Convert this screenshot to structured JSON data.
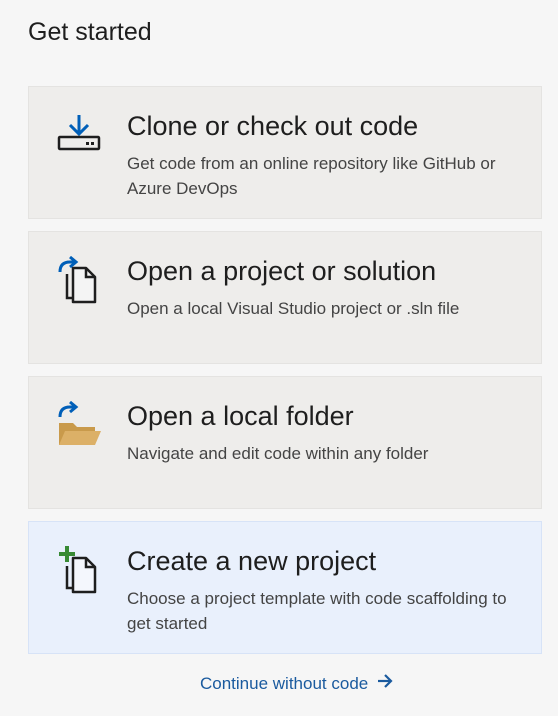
{
  "header": {
    "title": "Get started"
  },
  "cards": [
    {
      "icon": "clone-download-icon",
      "title": "Clone or check out code",
      "description": "Get code from an online repository like GitHub or Azure DevOps"
    },
    {
      "icon": "open-project-icon",
      "title": "Open a project or solution",
      "description": "Open a local Visual Studio project or .sln file"
    },
    {
      "icon": "open-folder-icon",
      "title": "Open a local folder",
      "description": "Navigate and edit code within any folder"
    },
    {
      "icon": "new-project-icon",
      "title": "Create a new project",
      "description": "Choose a project template with code scaffolding to get started",
      "selected": true
    }
  ],
  "footer": {
    "continue_label": "Continue without code"
  },
  "colors": {
    "accent_blue": "#005fb8",
    "link_blue": "#1a5a9e",
    "folder_yellow": "#dcb067",
    "plus_green": "#388a34",
    "card_bg": "#eeedeb",
    "card_selected_bg": "#e9f0fc"
  }
}
